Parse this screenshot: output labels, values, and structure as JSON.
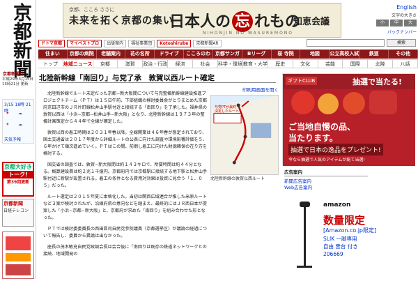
{
  "masthead": {
    "logo": "京都新聞",
    "small_logo": "京都新聞社",
    "date": "平成29年3月15日 15時21分 更新"
  },
  "weather": {
    "title": "3/15 18時 21時",
    "link": "天気予報"
  },
  "sidebar_ads": {
    "ad1_top": "京都大好き",
    "ad1_mid": "トーク!",
    "ad1_bottom": "第39回更新",
    "ad2_title": "京都新聞",
    "ad2_sub": "日経テレコン"
  },
  "banner": {
    "line1": "京都、こころ ささに",
    "line2": "未来を拓く京都の集い",
    "big_pre": "日本人の",
    "big_circle": "忘",
    "big_post": "れもの",
    "sub": "NIHONJIN NO WASUREMONO",
    "right": "知恵会議"
  },
  "top_right": {
    "english": "English",
    "size": "文字の大きさ",
    "backnumber": "バックナンバー"
  },
  "service_bar": [
    "ドトマ京都",
    "マイベストプロ",
    "出版案内",
    "福祉事業団",
    "Kotoshirube",
    "京都新聞AR"
  ],
  "search": {
    "placeholder": "",
    "button": "検索"
  },
  "nav_main": [
    "住まい",
    "京都の病院",
    "老舗案内",
    "花の名所",
    "ドライブ",
    "こころのわ",
    "京都サンガ",
    "Bリーグ",
    "桜 寺院",
    "地図",
    "公立高校入試",
    "鉄道",
    "その他"
  ],
  "nav_sub": [
    "トップ",
    "地域ニュース",
    "京都",
    "滋賀",
    "政治・行政",
    "経済",
    "社会",
    "科学・環境",
    "教育・大学",
    "歴史",
    "文化",
    "芸能",
    "国際",
    "北陸",
    "八話"
  ],
  "article": {
    "headline": "北陸新幹線「南回り」与党了承　敦賀以西ルート確定",
    "print_link": "印刷用画面を開く",
    "paragraphs": [
      "北陸新幹線でルート未定だった京都−新大阪間について与党整備新幹線建設推進プロジェクトチーム（ＰＴ）は１５日午前、下部組織の検討委員会がとりまとめた京都府京田辺市のＪＲ片町線松井山手駅付近と接続する「南回り」を了承した。福井県の敦賀以西は「小浜−京都−松井山手−新大阪」となり、北陸新幹線は１９７３年の整備計画策定から４４年で全線が確定した。",
      "敦賀以西の着工時期は２０３１年春以降。全線開業は４６年春が想定されており、国土交通省は２０１７年度から詳細ルートの公表に向けた調査や環境影響評価を５、６年かけて順次進めていく。ＰＴはこの間、前倒し着工に向けた財源確保の在り方を検討する。",
      "国交省の調査では、敦賀−新大阪間は約１４３キロで、所要時間は約４４分となる。概算建設費は約２兆１千億円。京都府内では京都駅に接続する地下駅と松井山手駅付近に新駅が設置される。着工の条件となる費用対効果は投資に見合う「１．０５」だった。",
      "ルート選定は２０１５年夏に本格化した。当初は関西広域連合が推した米原ルートなど３案が検討されたが、沿線府県の意向などを踏まえ、最終的にはＪＲ西日本が提案した「小浜−京都−新大阪」と、京都府が求めた「南回り」を組み合わせた形となった。",
      "ＰＴでは検討委委員長の西田昌司自民党参院議員（京都選挙区）が議論の経過について報告し、委員から異論は出なかった。",
      "座長の茂木敏充自民党政調会長は会合後に「南回りは既存の鉄道ネットワークとの接続、地域開発の"
    ],
    "map_caption": "北陸新幹線の敦賀以西ルート",
    "map_legend": "与党PTが最終決定したルート"
  },
  "right_ad": {
    "logo": "ギフトCLUB",
    "head": "抽選で当たる!",
    "t1": "ご当地自慢の品、",
    "t2": "当たります。",
    "t3": "抽選で日本の逸品をプレゼント!",
    "t4": "今なら抽選で人気のアイテムが総て当選!"
  },
  "pr": {
    "heading": "広告案内",
    "links": [
      "新聞広告案内",
      "Web広告案内"
    ]
  },
  "amazon": {
    "brand": "amazon",
    "limited": "数量限定",
    "link": "[Amazon.co.jp限定]",
    "desc1": "SLIK 一脚専用",
    "desc2": "自由 雲台 付き",
    "num": "206669"
  },
  "colors": {
    "nav_red": "#8a1818",
    "accent": "#c00"
  }
}
